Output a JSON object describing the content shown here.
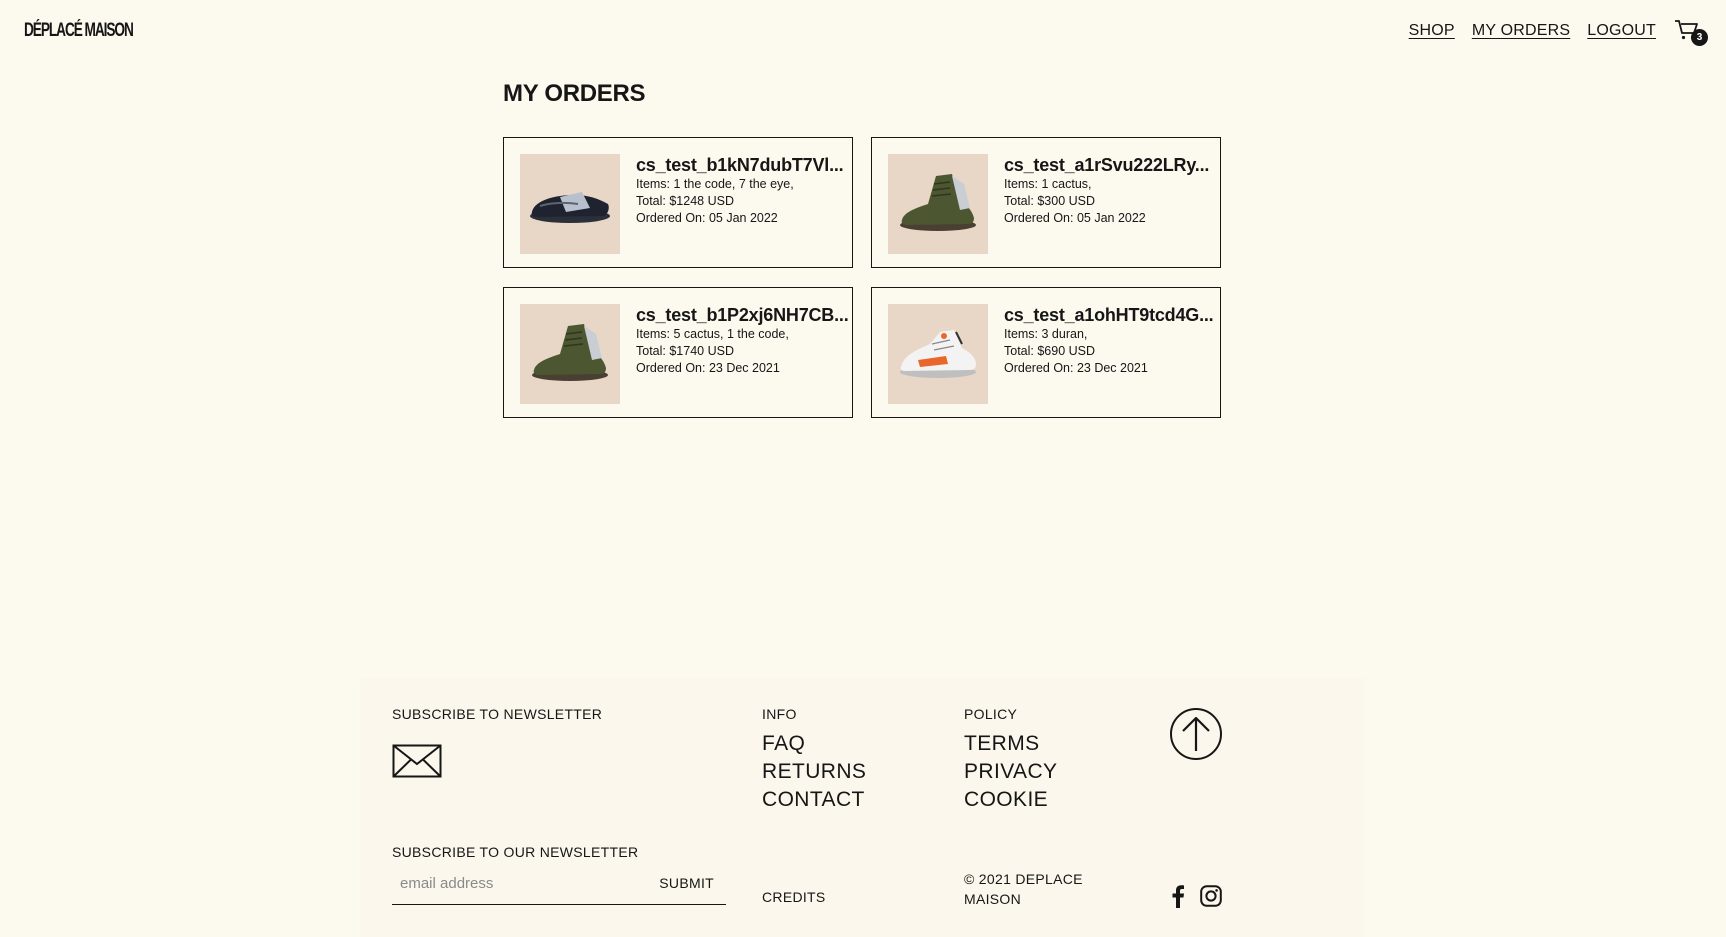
{
  "brand": {
    "logo_text": "DÉPLACÉ MAISON"
  },
  "nav": {
    "links": [
      {
        "label": "SHOP"
      },
      {
        "label": "MY ORDERS"
      },
      {
        "label": "LOGOUT"
      }
    ],
    "cart_count": "3",
    "cart_icon": "cart-icon"
  },
  "page": {
    "title": "MY ORDERS"
  },
  "orders": [
    {
      "id": "cs_test_b1kN7dubT7Vl...",
      "items": "Items: 1 the code, 7 the eye,",
      "total": "Total: $1248 USD",
      "ordered_on": "Ordered On: 05 Jan 2022",
      "image": "black-strap-sneaker"
    },
    {
      "id": "cs_test_a1rSvu222LRy...",
      "items": "Items: 1 cactus,",
      "total": "Total: $300 USD",
      "ordered_on": "Ordered On: 05 Jan 2022",
      "image": "olive-high-top-boot"
    },
    {
      "id": "cs_test_b1P2xj6NH7CB...",
      "items": "Items: 5 cactus, 1 the code,",
      "total": "Total: $1740 USD",
      "ordered_on": "Ordered On: 23 Dec 2021",
      "image": "olive-high-top-boot"
    },
    {
      "id": "cs_test_a1ohHT9tcd4G...",
      "items": "Items: 3 duran,",
      "total": "Total: $690 USD",
      "ordered_on": "Ordered On: 23 Dec 2021",
      "image": "white-orange-sneaker"
    }
  ],
  "footer": {
    "subscribe_heading": "SUBSCRIBE TO NEWSLETTER",
    "info_heading": "INFO",
    "info_links": [
      "FAQ",
      "RETURNS",
      "CONTACT"
    ],
    "policy_heading": "POLICY",
    "policy_links": [
      "TERMS",
      "PRIVACY",
      "COOKIE"
    ],
    "newsletter_heading": "SUBSCRIBE TO OUR NEWSLETTER",
    "email_placeholder": "email address",
    "submit_label": "SUBMIT",
    "credits": "CREDITS",
    "copyright_line1": "© 2021 DEPLACE",
    "copyright_line2": "MAISON",
    "social": [
      "facebook-icon",
      "instagram-icon"
    ]
  },
  "colors": {
    "background": "#fcf9ef",
    "text": "#161616",
    "image_bg": "#e8d6c6"
  }
}
